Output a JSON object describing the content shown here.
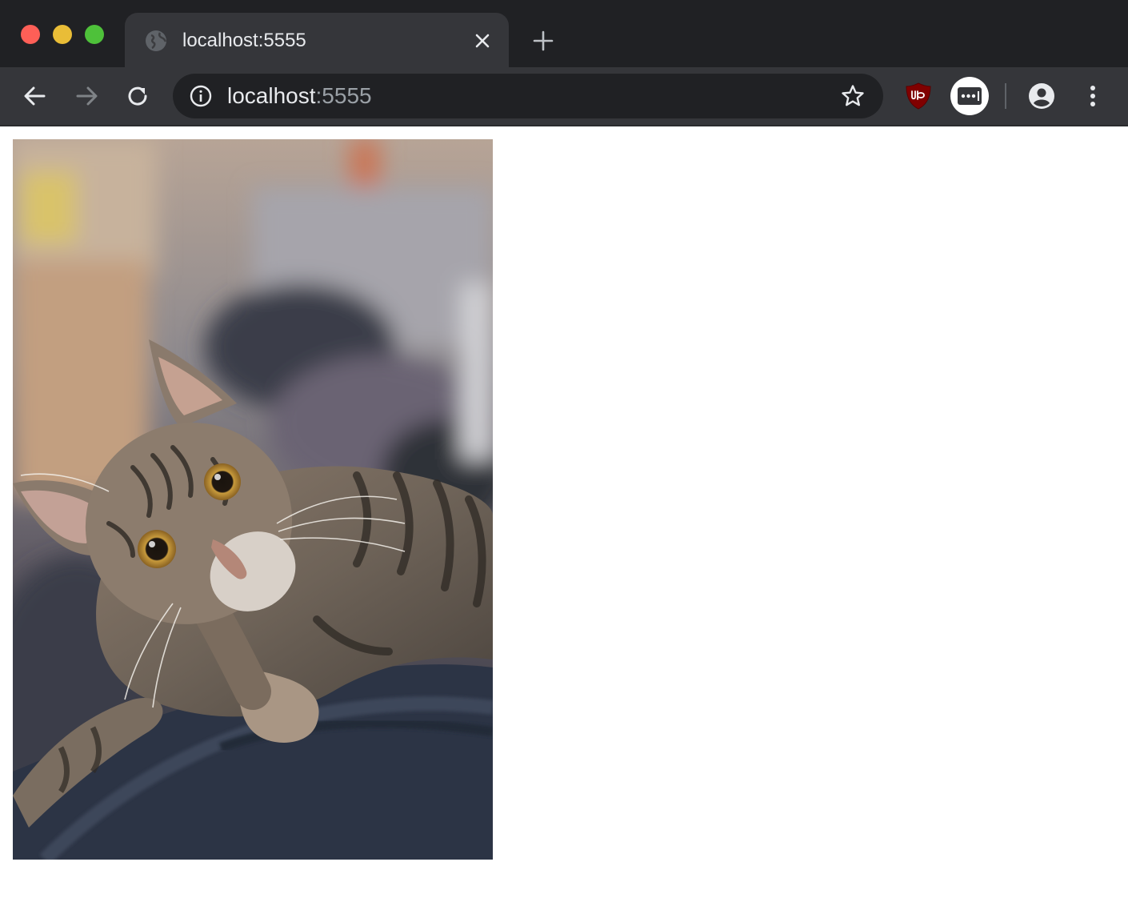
{
  "window": {
    "traffic_lights": [
      "close",
      "minimize",
      "maximize"
    ]
  },
  "tab": {
    "title": "localhost:5555",
    "favicon": "globe-icon",
    "close_icon": "close-icon"
  },
  "new_tab_icon": "plus-icon",
  "toolbar": {
    "back_icon": "arrow-left-icon",
    "forward_icon": "arrow-right-icon",
    "reload_icon": "reload-icon",
    "omnibox": {
      "info_icon": "info-icon",
      "host": "localhost",
      "port": ":5555",
      "bookmark_icon": "star-icon"
    },
    "extensions": [
      "ublock-origin-icon",
      "lastpass-icon"
    ],
    "profile_icon": "account-icon",
    "menu_icon": "kebab-menu-icon"
  },
  "page": {
    "image": {
      "subject": "tabby kitten on dark blue blanket"
    }
  },
  "colors": {
    "titlebar": "#202124",
    "tab_active": "#35363a",
    "omnibox_bg": "#202124",
    "text_primary": "#e8eaed",
    "text_secondary": "#9aa0a6",
    "ublock_red": "#800000"
  }
}
